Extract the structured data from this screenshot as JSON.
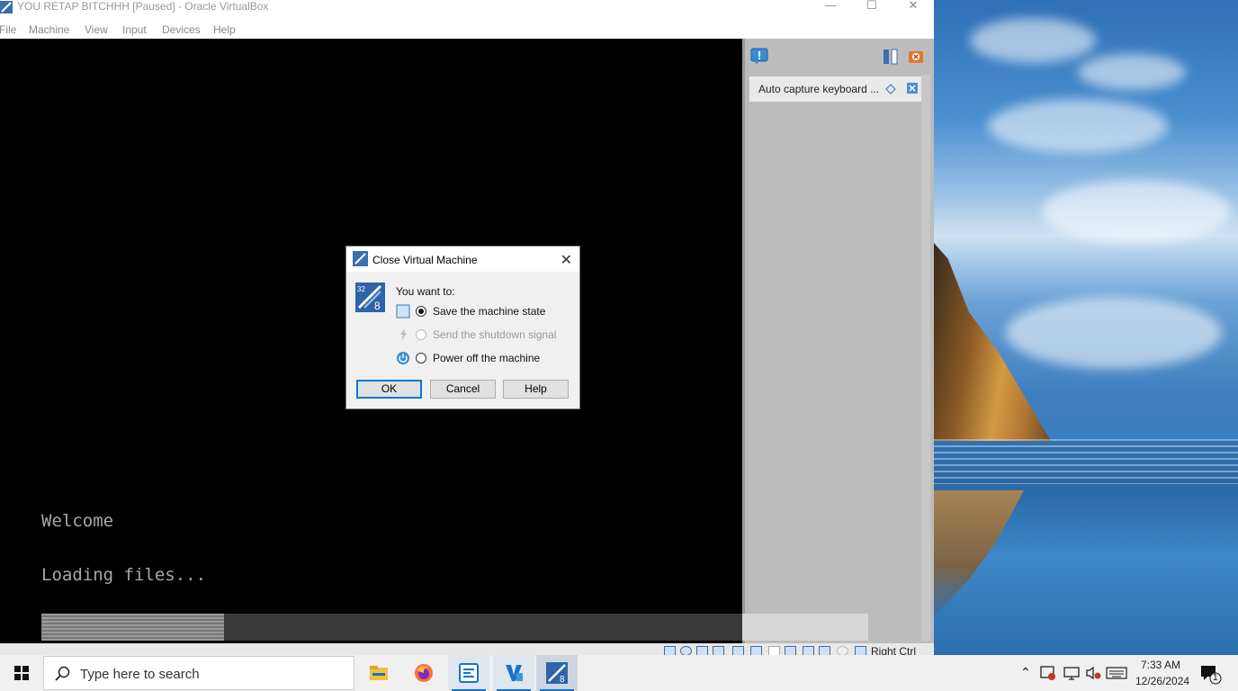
{
  "window": {
    "title": "YOU RETAP BITCHHH [Paused] - Oracle VirtualBox",
    "minimize": "—",
    "maximize": "☐",
    "close": "✕"
  },
  "menu": [
    "File",
    "Machine",
    "View",
    "Input",
    "Devices",
    "Help"
  ],
  "vm_screen": {
    "welcome": "Welcome",
    "loading": "Loading files...",
    "progress_fraction": 0.26
  },
  "side_panel": {
    "notification": "Auto capture keyboard ..."
  },
  "statusbar": {
    "host_key": "Right Ctrl"
  },
  "dialog": {
    "title": "Close Virtual Machine",
    "prompt": "You want to:",
    "options": [
      {
        "label": "Save the machine state",
        "selected": true,
        "enabled": true
      },
      {
        "label": "Send the shutdown signal",
        "selected": false,
        "enabled": false
      },
      {
        "label": "Power off the machine",
        "selected": false,
        "enabled": true
      }
    ],
    "buttons": {
      "ok": "OK",
      "cancel": "Cancel",
      "help": "Help"
    }
  },
  "taskbar": {
    "search_placeholder": "Type here to search",
    "apps": [
      "file-explorer",
      "firefox",
      "virtualbox-manager",
      "virtualbox-vm",
      "virtualbox-vm-active"
    ],
    "time": "7:33 AM",
    "date": "12/26/2024",
    "notification_count": "1"
  },
  "colors": {
    "accent": "#0078d7",
    "vm_background": "#000000",
    "terminal_text": "#a8a8a8"
  }
}
